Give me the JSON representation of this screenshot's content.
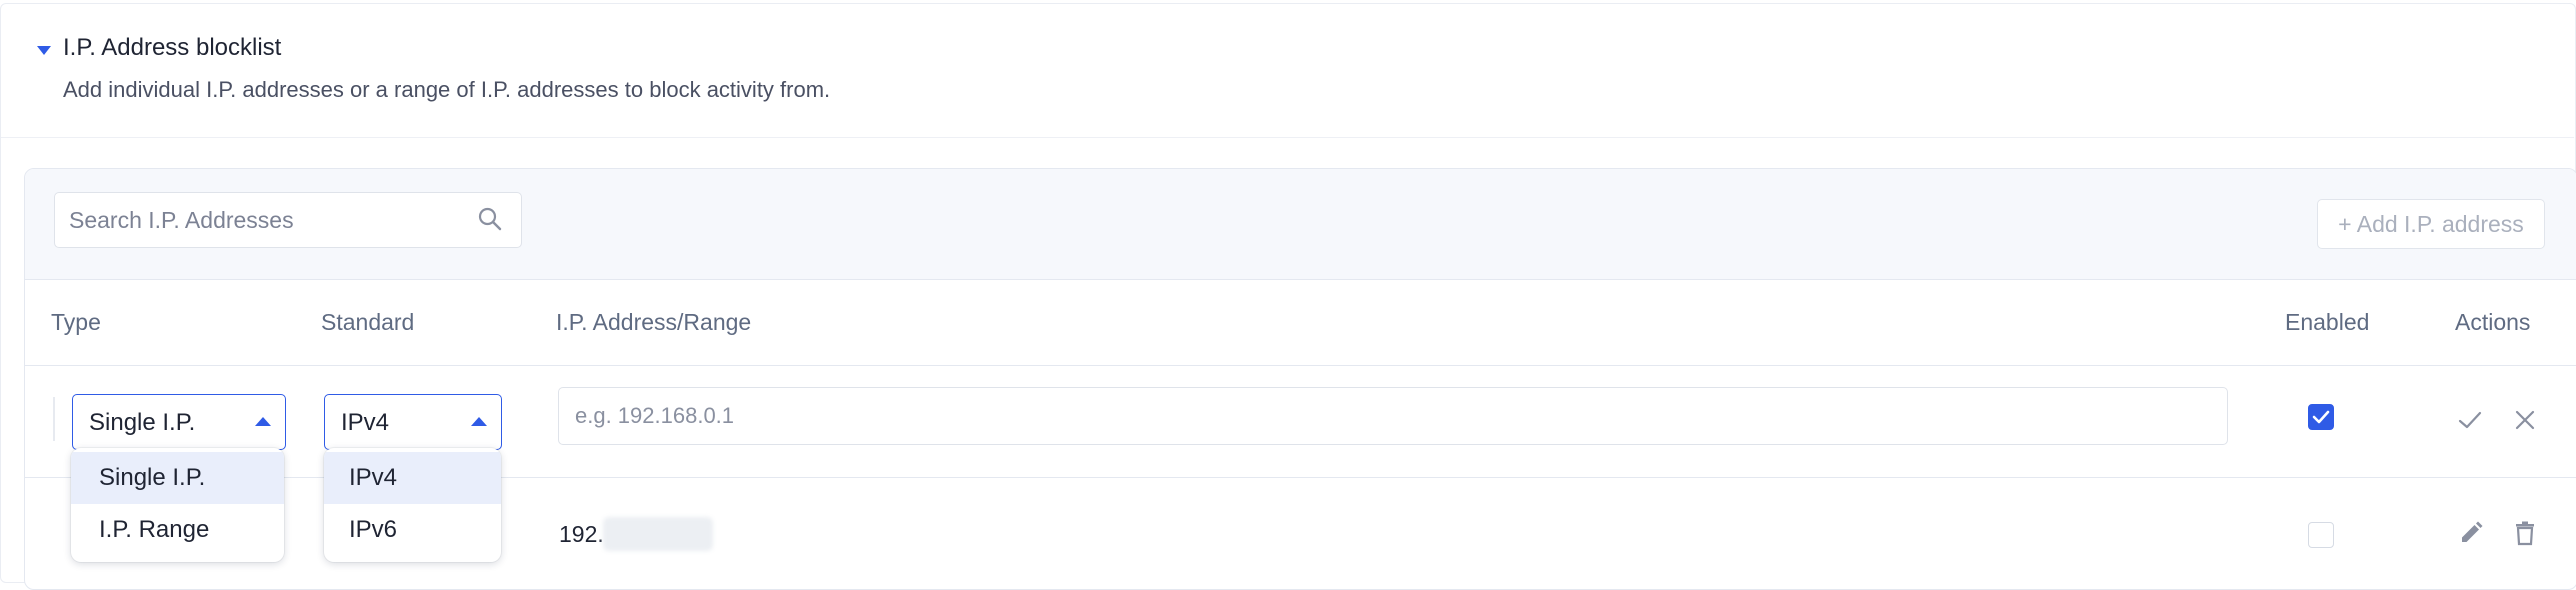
{
  "section": {
    "title": "I.P. Address blocklist",
    "description": "Add individual I.P. addresses or a range of I.P. addresses to block activity from."
  },
  "toolbar": {
    "search_placeholder": "Search I.P. Addresses",
    "add_button_label": "+ Add I.P. address"
  },
  "table": {
    "columns": {
      "type": "Type",
      "standard": "Standard",
      "address": "I.P. Address/Range",
      "enabled": "Enabled",
      "actions": "Actions"
    },
    "new_row": {
      "type_value": "Single I.P.",
      "standard_value": "IPv4",
      "address_placeholder": "e.g. 192.168.0.1",
      "enabled": true
    },
    "rows": [
      {
        "address_visible": "192.",
        "enabled": false
      }
    ]
  },
  "type_menu": {
    "options": [
      "Single I.P.",
      "I.P. Range"
    ],
    "selected": "Single I.P."
  },
  "standard_menu": {
    "options": [
      "IPv4",
      "IPv6"
    ],
    "selected": "IPv4"
  },
  "icons": {
    "collapse": "caret-down-icon",
    "search": "search-icon",
    "confirm": "check-icon",
    "cancel": "close-icon",
    "edit": "pencil-icon",
    "delete": "trash-icon"
  },
  "colors": {
    "accent": "#2f5be6",
    "muted_text": "#5f6b82",
    "toolbar_bg": "#f6f8fc",
    "selected_option_bg": "#e9eefb"
  }
}
